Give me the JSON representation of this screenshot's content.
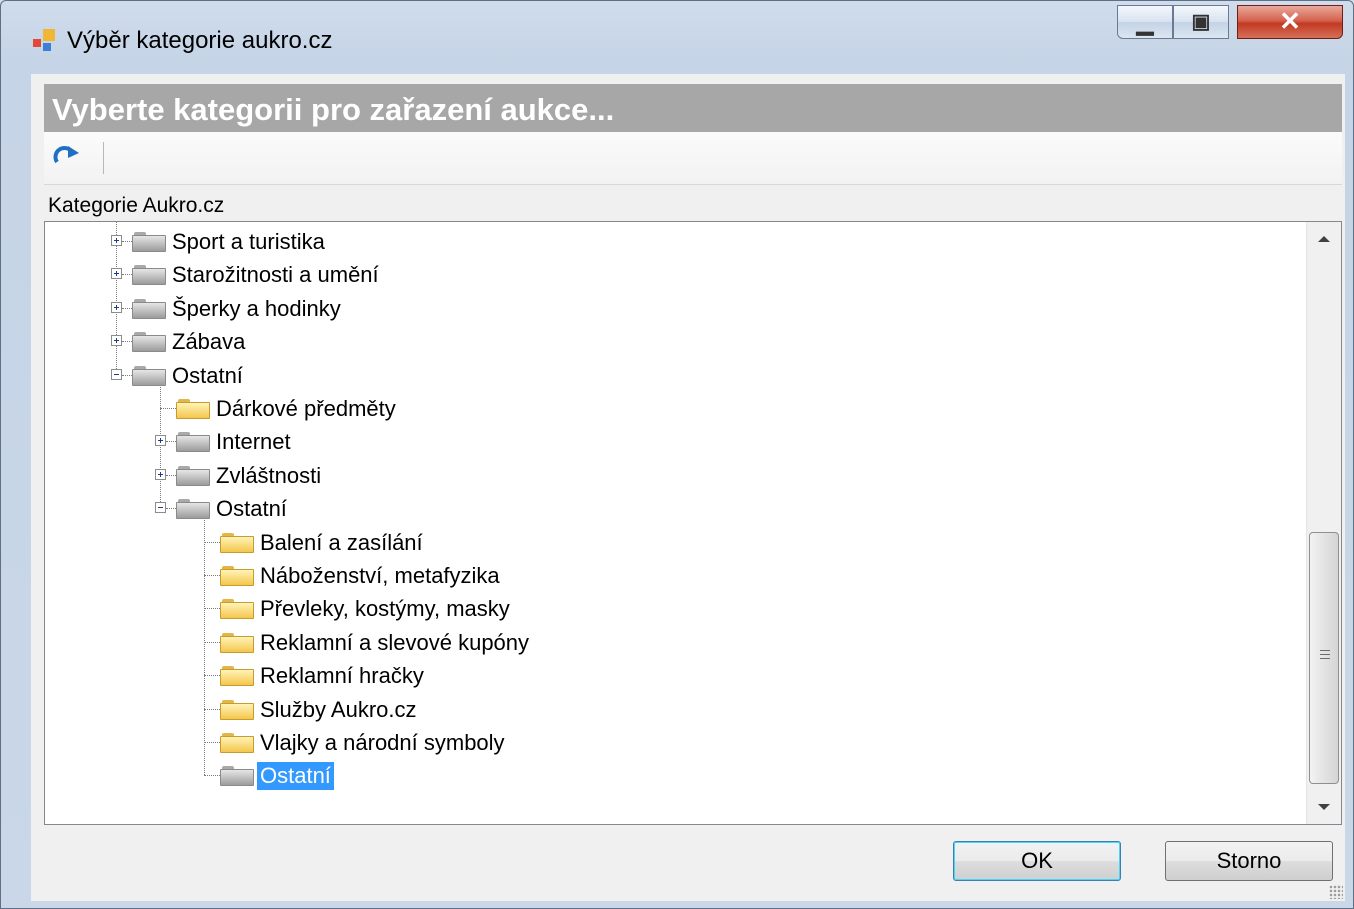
{
  "window": {
    "title": "Výběr kategorie aukro.cz",
    "icon": "window-app-icon",
    "controls": {
      "minimize": "minimize-icon",
      "maximize": "maximize-icon",
      "close": "close-icon"
    }
  },
  "header": {
    "banner_text": "Vyberte kategorii pro zařazení aukce..."
  },
  "toolbar": {
    "refresh_icon": "refresh-icon"
  },
  "tree": {
    "label": "Kategorie Aukro.cz",
    "nodes": [
      {
        "label": "Sport a turistika",
        "level": 1,
        "expander": "plus",
        "folder": "gray"
      },
      {
        "label": "Starožitnosti a umění",
        "level": 1,
        "expander": "plus",
        "folder": "gray"
      },
      {
        "label": "Šperky a hodinky",
        "level": 1,
        "expander": "plus",
        "folder": "gray"
      },
      {
        "label": "Zábava",
        "level": 1,
        "expander": "plus",
        "folder": "gray"
      },
      {
        "label": "Ostatní",
        "level": 1,
        "expander": "minus",
        "folder": "gray"
      },
      {
        "label": "Dárkové předměty",
        "level": 2,
        "expander": "none",
        "folder": "yellow"
      },
      {
        "label": "Internet",
        "level": 2,
        "expander": "plus",
        "folder": "gray"
      },
      {
        "label": "Zvláštnosti",
        "level": 2,
        "expander": "plus",
        "folder": "gray"
      },
      {
        "label": "Ostatní",
        "level": 2,
        "expander": "minus",
        "folder": "gray"
      },
      {
        "label": "Balení a zasílání",
        "level": 3,
        "expander": "none",
        "folder": "yellow"
      },
      {
        "label": "Náboženství, metafyzika",
        "level": 3,
        "expander": "none",
        "folder": "yellow"
      },
      {
        "label": "Převleky, kostýmy, masky",
        "level": 3,
        "expander": "none",
        "folder": "yellow"
      },
      {
        "label": "Reklamní a slevové kupóny",
        "level": 3,
        "expander": "none",
        "folder": "yellow"
      },
      {
        "label": "Reklamní hračky",
        "level": 3,
        "expander": "none",
        "folder": "yellow"
      },
      {
        "label": "Služby Aukro.cz",
        "level": 3,
        "expander": "none",
        "folder": "yellow"
      },
      {
        "label": "Vlajky a národní symboly",
        "level": 3,
        "expander": "none",
        "folder": "yellow"
      },
      {
        "label": "Ostatní",
        "level": 3,
        "expander": "none",
        "folder": "gray",
        "selected": true
      }
    ]
  },
  "buttons": {
    "ok": "OK",
    "cancel": "Storno"
  },
  "colors": {
    "selection": "#3399ff",
    "banner": "#a7a7a7",
    "close_button": "#c23a22"
  }
}
